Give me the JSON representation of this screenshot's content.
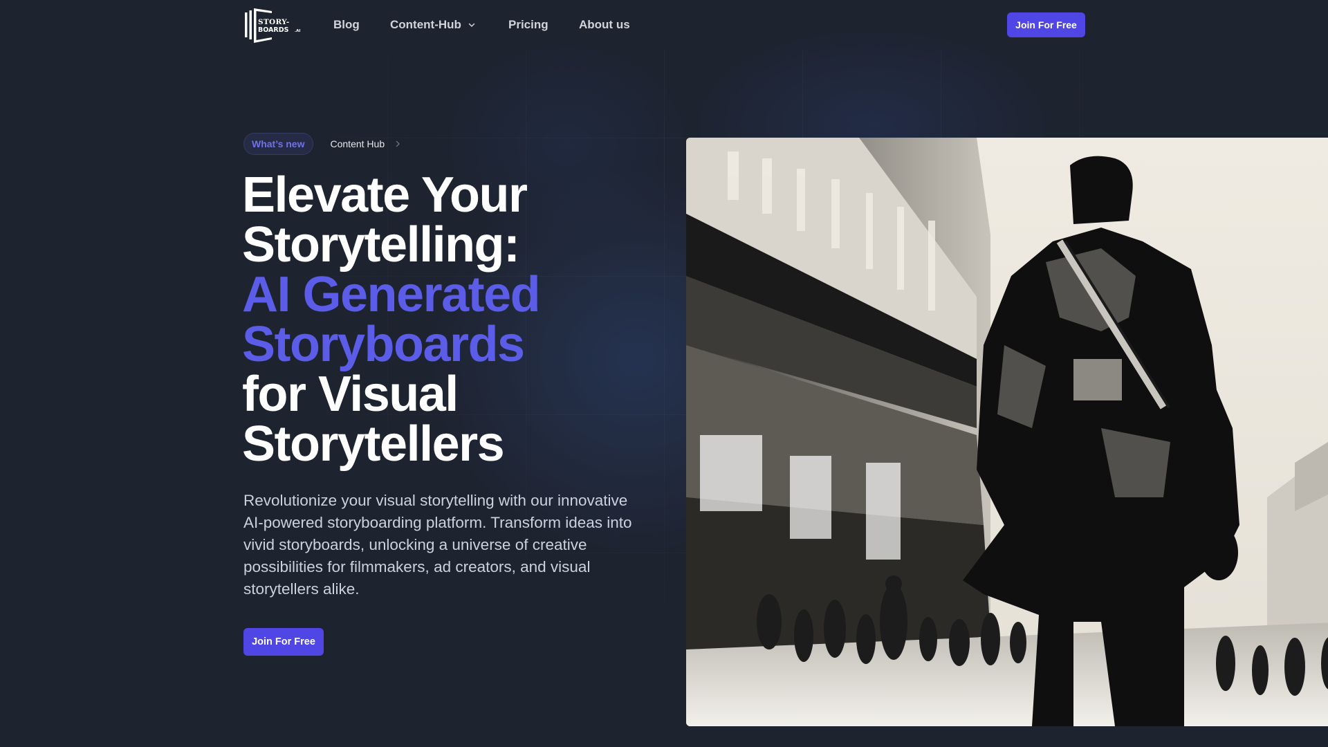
{
  "brand": {
    "logo_line1": "STORY-",
    "logo_line2": "BOARDS",
    "logo_suffix": ".AI",
    "icon": "storyboards-logo-icon"
  },
  "nav": {
    "items": [
      {
        "label": "Blog"
      },
      {
        "label": "Content-Hub",
        "has_dropdown": true,
        "icon": "chevron-down-icon"
      },
      {
        "label": "Pricing"
      },
      {
        "label": "About us"
      }
    ],
    "cta_label": "Join For Free"
  },
  "hero": {
    "badge_label": "What’s new",
    "breadcrumb_label": "Content Hub",
    "breadcrumb_icon": "chevron-right-icon",
    "headline_lines": [
      {
        "text": "Elevate Your",
        "accent": false
      },
      {
        "text": "Storytelling:",
        "accent": false
      },
      {
        "text": "AI Generated",
        "accent": true
      },
      {
        "text": "Storyboards",
        "accent": true
      },
      {
        "text": "for Visual",
        "accent": false
      },
      {
        "text": "Storytellers",
        "accent": false
      }
    ],
    "description": "Revolutionize your visual storytelling with our innovative AI-powered storyboarding platform. Transform ideas into vivid storyboards, unlocking a universe of creative possibilities for filmmakers, ad creators, and visual storytellers alike.",
    "cta_label": "Join For Free",
    "image_alt": "Black and white ink storyboard illustration of a man in a trench coat walking down a busy city street"
  },
  "colors": {
    "background": "#1e2330",
    "accent": "#4f46e5",
    "headline_accent": "#5b5ce8",
    "badge_text": "#7072e6"
  }
}
